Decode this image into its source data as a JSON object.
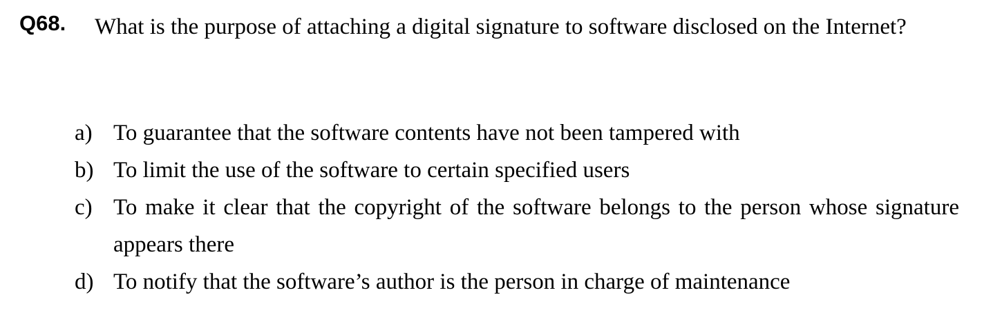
{
  "question": {
    "number": "Q68.",
    "text": "What is the purpose of attaching a digital signature to software disclosed on the Internet?"
  },
  "options": [
    {
      "label": "a)",
      "text": "To guarantee that the software contents have not been tampered with"
    },
    {
      "label": "b)",
      "text": "To limit the use of the software to certain specified users"
    },
    {
      "label": "c)",
      "text": "To make it clear that the copyright of the software belongs to the person whose signature appears there"
    },
    {
      "label": "d)",
      "text": "To notify that the software’s author is the person in charge of maintenance"
    }
  ]
}
